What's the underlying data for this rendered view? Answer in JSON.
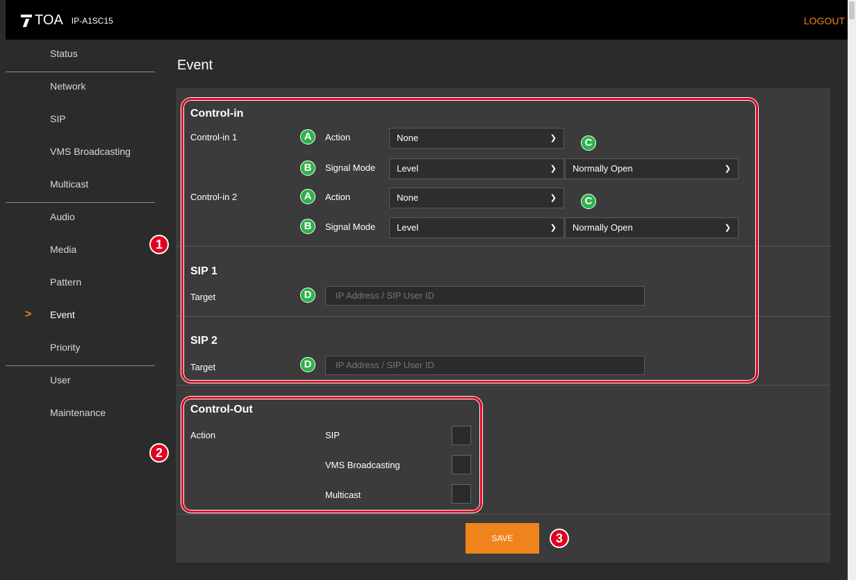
{
  "header": {
    "brand": "TOA",
    "model": "IP-A1SC15",
    "logout": "LOGOUT"
  },
  "sidebar": {
    "items": [
      {
        "label": "Status"
      },
      {
        "label": "Network"
      },
      {
        "label": "SIP"
      },
      {
        "label": "VMS Broadcasting"
      },
      {
        "label": "Multicast"
      },
      {
        "label": "Audio"
      },
      {
        "label": "Media"
      },
      {
        "label": "Pattern"
      },
      {
        "label": "Event",
        "active": true
      },
      {
        "label": "Priority"
      },
      {
        "label": "User"
      },
      {
        "label": "Maintenance"
      }
    ],
    "active_marker": ">"
  },
  "page": {
    "title": "Event"
  },
  "control_in": {
    "heading": "Control-in",
    "ports": [
      {
        "label": "Control-in 1",
        "action_label": "Action",
        "action_value": "None",
        "signal_label": "Signal Mode",
        "signal_value": "Level",
        "contact_value": "Normally Open"
      },
      {
        "label": "Control-in 2",
        "action_label": "Action",
        "action_value": "None",
        "signal_label": "Signal Mode",
        "signal_value": "Level",
        "contact_value": "Normally Open"
      }
    ]
  },
  "sip1": {
    "heading": "SIP 1",
    "target_label": "Target",
    "placeholder": "IP Address / SIP User ID"
  },
  "sip2": {
    "heading": "SIP 2",
    "target_label": "Target",
    "placeholder": "IP Address / SIP User ID"
  },
  "control_out": {
    "heading": "Control-Out",
    "action_label": "Action",
    "options": [
      {
        "label": "SIP",
        "checked": false
      },
      {
        "label": "VMS Broadcasting",
        "checked": false
      },
      {
        "label": "Multicast",
        "checked": false
      }
    ]
  },
  "save_label": "SAVE",
  "callouts": {
    "numbers": [
      "1",
      "2",
      "3"
    ],
    "letters": [
      "A",
      "B",
      "C",
      "D"
    ]
  },
  "colors": {
    "accent": "#f0841c",
    "callout_red": "#e00020",
    "callout_green": "#2db34a"
  }
}
